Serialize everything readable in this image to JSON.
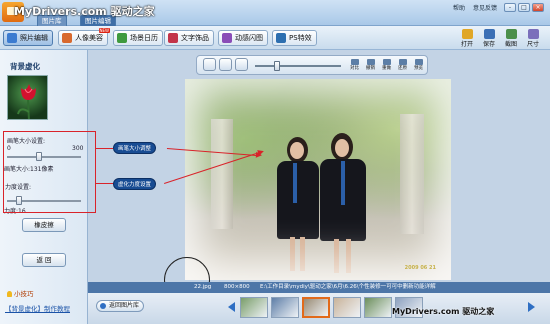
{
  "app": {
    "watermark_top": "MyDrivers.com 驱动之家",
    "title_tabs": [
      "图片库",
      "图片编辑"
    ],
    "title_links": [
      "帮助",
      "意见反馈"
    ],
    "window_buttons": [
      "-",
      "□",
      "×"
    ]
  },
  "toolbar": {
    "tabs": [
      {
        "label": "照片编辑",
        "active": true,
        "icon": "photo-edit-icon",
        "color": "#3b7bd0"
      },
      {
        "label": "人像美容",
        "active": false,
        "icon": "portrait-icon",
        "color": "#d8692e",
        "badge": "NEW"
      },
      {
        "label": "场景日历",
        "active": false,
        "icon": "calendar-icon",
        "color": "#3f9a3f"
      },
      {
        "label": "文字饰品",
        "active": false,
        "icon": "text-deco-icon",
        "color": "#c3344a"
      },
      {
        "label": "动感闪图",
        "active": false,
        "icon": "flash-icon",
        "color": "#8a4cb7"
      },
      {
        "label": "PS特效",
        "active": false,
        "icon": "ps-effect-icon",
        "color": "#2d6fb0"
      }
    ],
    "right_buttons": [
      {
        "label": "打开",
        "icon": "open-icon",
        "color": "#e0a727"
      },
      {
        "label": "保存",
        "icon": "save-icon",
        "color": "#3b6fb5"
      },
      {
        "label": "截图",
        "icon": "screenshot-icon",
        "color": "#4b8f4b"
      },
      {
        "label": "尺寸",
        "icon": "size-icon",
        "color": "#7a6fbb"
      }
    ]
  },
  "left_panel": {
    "title": "背景虚化",
    "brush_size_label": "画笔大小设置:",
    "brush_min": "0",
    "brush_max": "300",
    "brush_value": 131,
    "brush_max_value": 300,
    "brush_readout": "画笔大小:131像素",
    "strength_label": "力度设置:",
    "strength_value": 16,
    "strength_max_value": 100,
    "strength_readout": "力度:16",
    "eraser_button": "橡皮擦",
    "back_button": "返  回",
    "tips": "小技巧",
    "tutorial_link": "【背景虚化】制作教程"
  },
  "annotations": {
    "brush_callout": "画笔大小调整",
    "strength_callout": "虚化力度设置"
  },
  "canvas_toolbar": {
    "buttons": [
      "rotate-icon",
      "fit-icon",
      "actual-size-icon"
    ],
    "zoom_value": 0.25,
    "text_buttons": [
      {
        "label": "对比",
        "icon": "compare-icon"
      },
      {
        "label": "撤销",
        "icon": "undo-icon"
      },
      {
        "label": "重做",
        "icon": "redo-icon"
      },
      {
        "label": "还原",
        "icon": "restore-icon"
      },
      {
        "label": "预览",
        "icon": "preview-icon"
      }
    ]
  },
  "photo": {
    "stamp": "2009 06 21"
  },
  "statusbar": {
    "filename": "22.jpg",
    "dimensions": "800×800",
    "path": "E:\\工作目录\\mydiy\\驱动之家\\6月\\6.26\\个性装修一可可中删新功能详解"
  },
  "filmstrip": {
    "back_label": "返回图片库",
    "selected_index": 2,
    "thumb_colors": [
      "#7a9e6a",
      "#5f7fa8",
      "#9a8b74",
      "#c9b39a",
      "#6c8f5c",
      "#8ea2c0"
    ]
  },
  "watermark_bottom": "MyDrivers.com 驱动之家"
}
